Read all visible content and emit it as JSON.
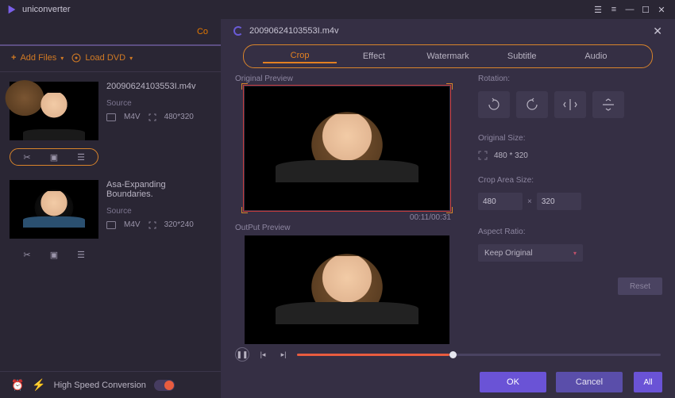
{
  "app": {
    "title": "uniconverter"
  },
  "topnav": {
    "convert_label": "Co"
  },
  "toolbar": {
    "add_files": "Add Files",
    "load_dvd": "Load DVD"
  },
  "files": [
    {
      "name": "20090624103553I.m4v",
      "source_label": "Source",
      "format": "M4V",
      "dimensions": "480*320"
    },
    {
      "name": "Asa-Expanding Boundaries.",
      "source_label": "Source",
      "format": "M4V",
      "dimensions": "320*240"
    }
  ],
  "bottom": {
    "high_speed_label": "High Speed Conversion"
  },
  "panel": {
    "filename": "20090624103553I.m4v",
    "tabs": {
      "crop": "Crop",
      "effect": "Effect",
      "watermark": "Watermark",
      "subtitle": "Subtitle",
      "audio": "Audio"
    },
    "preview": {
      "original_label": "Original Preview",
      "output_label": "OutPut Preview",
      "timecode": "00:11/00:31"
    },
    "settings": {
      "rotation_label": "Rotation:",
      "original_size_label": "Original Size:",
      "original_size_value": "480 * 320",
      "crop_area_label": "Crop Area Size:",
      "crop_w": "480",
      "crop_h": "320",
      "aspect_label": "Aspect Ratio:",
      "aspect_selected": "Keep Original",
      "reset": "Reset"
    },
    "footer": {
      "ok": "OK",
      "cancel": "Cancel",
      "all": "All"
    }
  }
}
